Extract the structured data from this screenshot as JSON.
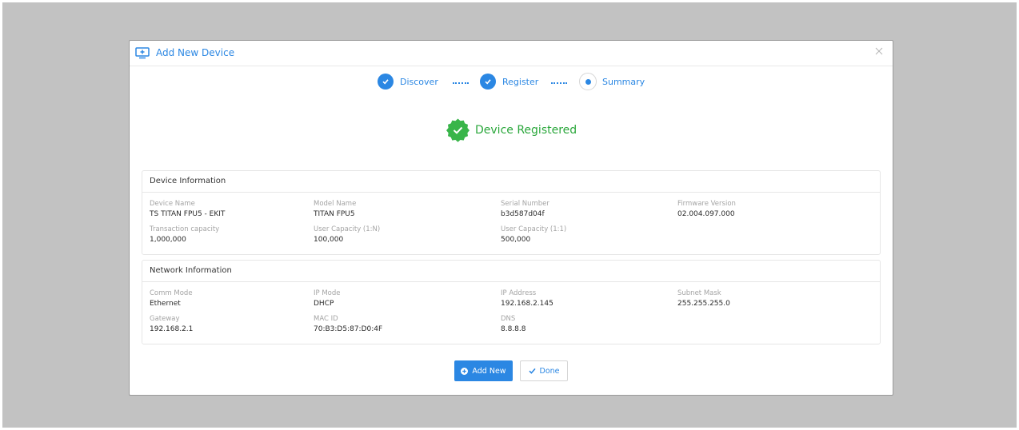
{
  "modal": {
    "title": "Add New Device",
    "icons": {
      "header": "monitor-plus-icon",
      "close": "close-icon"
    }
  },
  "stepper": {
    "steps": [
      {
        "label": "Discover",
        "state": "completed"
      },
      {
        "label": "Register",
        "state": "completed"
      },
      {
        "label": "Summary",
        "state": "current"
      }
    ]
  },
  "status": {
    "text": "Device Registered",
    "icon": "check-badge-icon"
  },
  "device_info": {
    "title": "Device Information",
    "fields": [
      {
        "label": "Device Name",
        "value": "TS TITAN FPU5 - EKIT"
      },
      {
        "label": "Model Name",
        "value": "TITAN FPU5"
      },
      {
        "label": "Serial Number",
        "value": "b3d587d04f"
      },
      {
        "label": "Firmware Version",
        "value": "02.004.097.000"
      },
      {
        "label": "Transaction capacity",
        "value": "1,000,000"
      },
      {
        "label": "User Capacity (1:N)",
        "value": "100,000"
      },
      {
        "label": "User Capacity (1:1)",
        "value": "500,000"
      }
    ]
  },
  "network_info": {
    "title": "Network Information",
    "fields": [
      {
        "label": "Comm Mode",
        "value": "Ethernet"
      },
      {
        "label": "IP Mode",
        "value": "DHCP"
      },
      {
        "label": "IP Address",
        "value": "192.168.2.145"
      },
      {
        "label": "Subnet Mask",
        "value": "255.255.255.0"
      },
      {
        "label": "Gateway",
        "value": "192.168.2.1"
      },
      {
        "label": "MAC ID",
        "value": "70:B3:D5:87:D0:4F"
      },
      {
        "label": "DNS",
        "value": "8.8.8.8"
      }
    ]
  },
  "actions": {
    "add_new": {
      "label": "Add New",
      "icon": "plus-circle-icon"
    },
    "done": {
      "label": "Done",
      "icon": "check-icon"
    }
  },
  "colors": {
    "accent": "#2b87e3",
    "success": "#2aa73b",
    "backdrop": "#c2c2c2"
  }
}
